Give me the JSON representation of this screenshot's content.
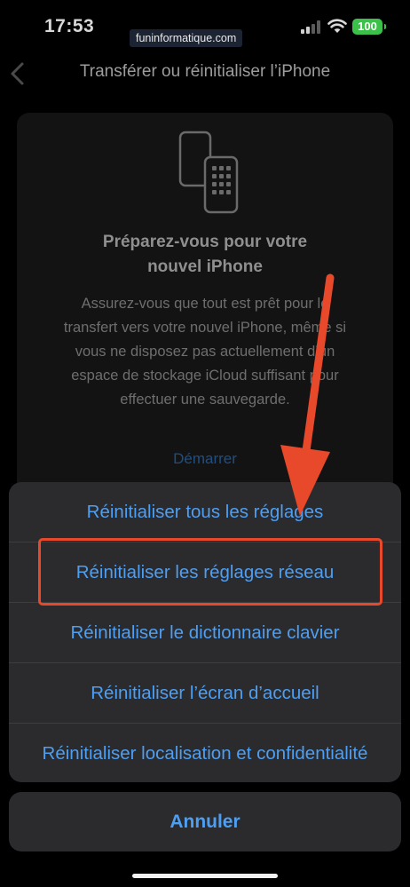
{
  "status_bar": {
    "time": "17:53",
    "watermark": "funinformatique.com",
    "battery": "100",
    "signal_bars_active": 2,
    "signal_bars_total": 4
  },
  "nav": {
    "back_icon": "chevron-left-icon",
    "title": "Transférer ou réinitialiser l’iPhone"
  },
  "card": {
    "icon": "two-phones-icon",
    "title_line1": "Préparez-vous pour votre",
    "title_line2": "nouvel iPhone",
    "text_lines": [
      "Assurez-vous que tout est prêt pour le",
      "transfert vers votre nouvel iPhone, même si",
      "vous ne disposez pas actuellement d’un",
      "espace de stockage iCloud suffisant pour",
      "effectuer une sauvegarde."
    ],
    "link": "Démarrer"
  },
  "action_sheet": {
    "items": [
      "Réinitialiser tous les réglages",
      "Réinitialiser les réglages réseau",
      "Réinitialiser le dictionnaire clavier",
      "Réinitialiser l’écran d’accueil",
      "Réinitialiser localisation et confidentialité"
    ],
    "cancel": "Annuler",
    "highlighted_item_index": 1
  },
  "colors": {
    "action_blue": "#4e9ef2",
    "annotation_red": "#e8492b",
    "battery_green": "#3bc14a",
    "sheet_bg": "#2b2b2d"
  }
}
